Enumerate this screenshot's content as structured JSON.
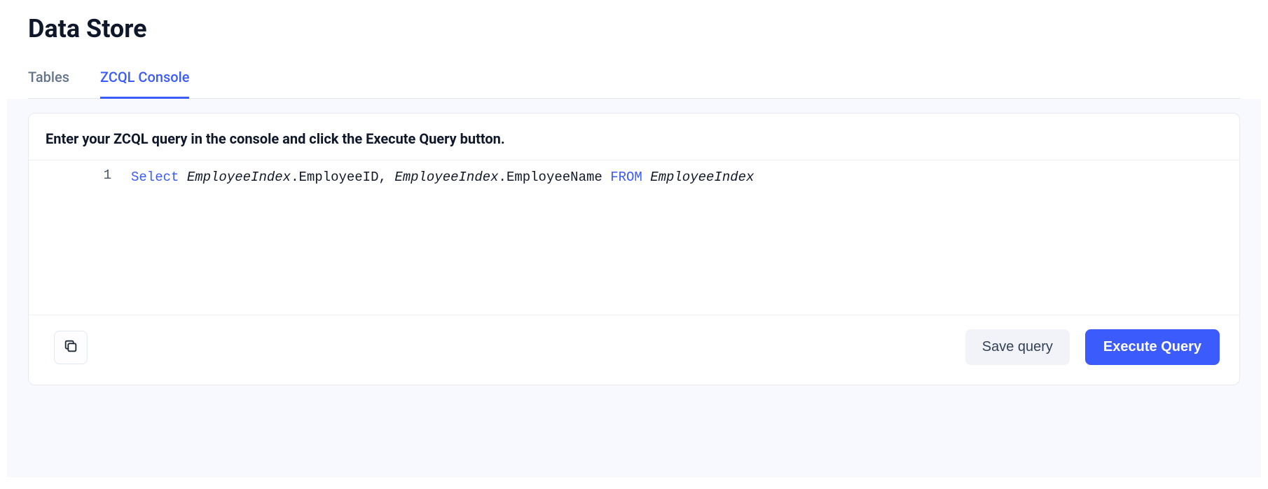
{
  "page": {
    "title": "Data Store"
  },
  "tabs": {
    "tables": "Tables",
    "zcql_console": "ZCQL Console"
  },
  "console": {
    "instruction": "Enter your ZCQL query in the console and click the Execute Query button.",
    "line_number": "1",
    "query_tokens": {
      "select": "Select",
      "tbl1": "EmployeeIndex",
      "col1": "EmployeeID",
      "tbl2": "EmployeeIndex",
      "col2": "EmployeeName",
      "from": "FROM",
      "tbl3": "EmployeeIndex"
    }
  },
  "buttons": {
    "save": "Save query",
    "execute": "Execute Query"
  },
  "icons": {
    "copy": "copy"
  }
}
